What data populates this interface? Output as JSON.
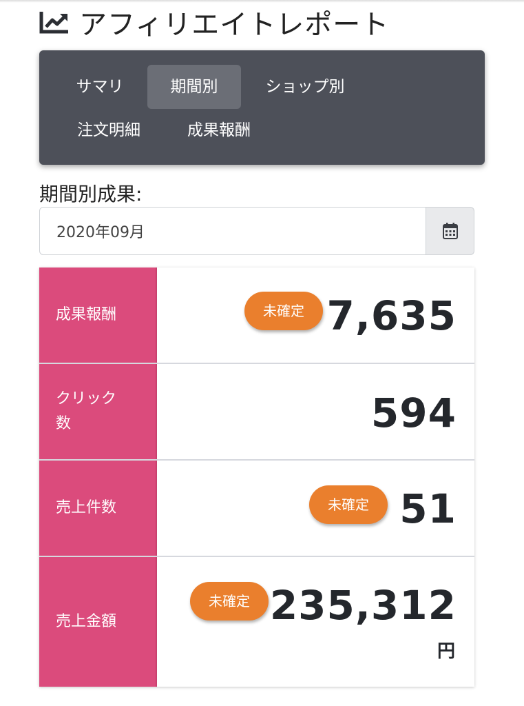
{
  "header": {
    "icon": "trending-up-chart-icon",
    "title": "アフィリエイトレポート"
  },
  "tabs": [
    {
      "label": "サマリ",
      "active": false
    },
    {
      "label": "期間別",
      "active": true
    },
    {
      "label": "ショップ別",
      "active": false
    },
    {
      "label": "注文明細",
      "active": false
    },
    {
      "label": "成果報酬",
      "active": false
    }
  ],
  "period": {
    "label": "期間別成果:",
    "value": "2020年09月",
    "calendar_icon": "calendar-icon"
  },
  "stats": [
    {
      "label": "成果報酬",
      "value": "7,635",
      "badge": "未確定"
    },
    {
      "label": "クリック数",
      "value": "594",
      "badge": ""
    },
    {
      "label": "売上件数",
      "value": "51",
      "badge": "未確定"
    },
    {
      "label": "売上金額",
      "value": "235,312",
      "badge": "未確定",
      "unit": "円"
    }
  ],
  "colors": {
    "tab_bar": "#4d5059",
    "tab_active": "#6b6e76",
    "label_bg": "#db4b7c",
    "badge_bg": "#ea7f2d"
  }
}
